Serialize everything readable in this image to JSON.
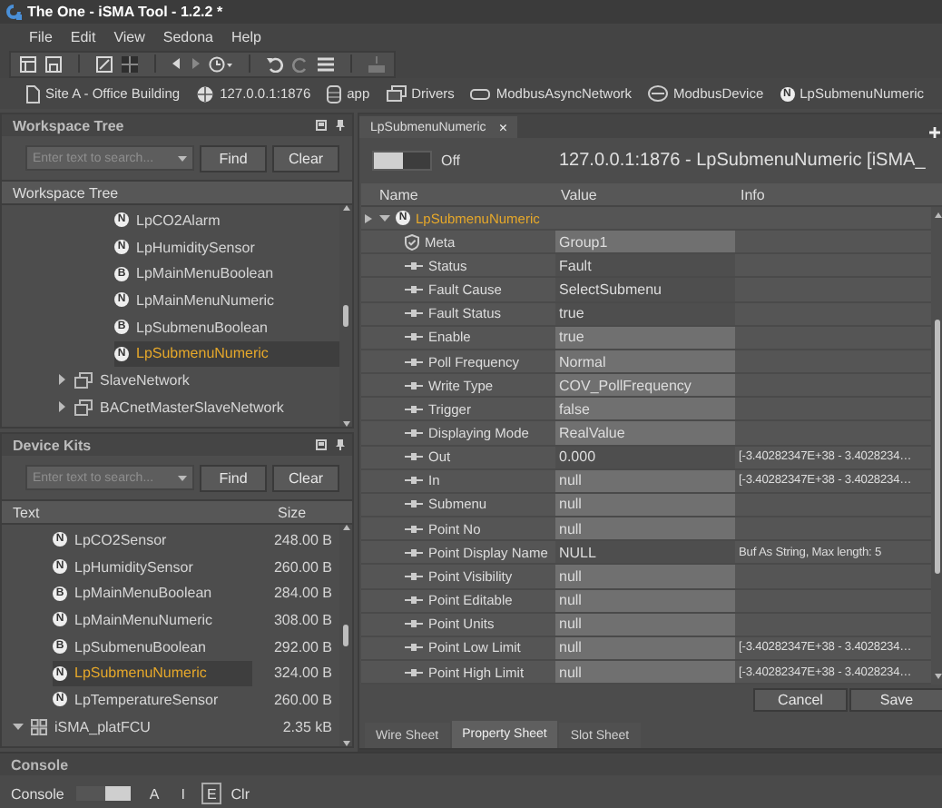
{
  "window": {
    "title": "The One - iSMA Tool - 1.2.2 *"
  },
  "menu": [
    "File",
    "Edit",
    "View",
    "Sedona",
    "Help"
  ],
  "breadcrumb": [
    {
      "label": "Site A - Office Building",
      "kind": "page"
    },
    {
      "label": "127.0.0.1:1876",
      "kind": "server"
    },
    {
      "label": "app",
      "kind": "database"
    },
    {
      "label": "Drivers",
      "kind": "folder"
    },
    {
      "label": "ModbusAsyncNetwork",
      "kind": "network"
    },
    {
      "label": "ModbusDevice",
      "kind": "device"
    },
    {
      "label": "LpSubmenuNumeric",
      "kind": "component",
      "badge": "N"
    }
  ],
  "workspace_tree": {
    "title": "Workspace Tree",
    "search": {
      "placeholder": "Enter text to search..."
    },
    "buttons": [
      "Find",
      "Clear"
    ],
    "column": "Workspace Tree",
    "items": [
      {
        "children": [
          {
            "label": "LpCO2Alarm",
            "badge": "N",
            "selected": false
          },
          {
            "label": "LpHumiditySensor",
            "badge": "N",
            "selected": false
          },
          {
            "label": "LpMainMenuBoolean",
            "badge": "B",
            "selected": false
          },
          {
            "label": "LpMainMenuNumeric",
            "badge": "N",
            "selected": false
          },
          {
            "label": "LpSubmenuBoolean",
            "badge": "B",
            "selected": false
          },
          {
            "label": "LpSubmenuNumeric",
            "badge": "N",
            "selected": true
          }
        ]
      },
      {
        "label": "SlaveNetwork",
        "kind": "network",
        "expanded": false,
        "selected": false
      },
      {
        "label": "BACnetMasterSlaveNetwork",
        "kind": "network",
        "expanded": false,
        "selected": false
      }
    ]
  },
  "device_kits": {
    "title": "Device Kits",
    "search": {
      "placeholder": "Enter text to search..."
    },
    "buttons": [
      "Find",
      "Clear"
    ],
    "columns": [
      "Text",
      "Size"
    ],
    "items": [
      {
        "children": [
          {
            "label": "LpCO2Sensor",
            "badge": "N",
            "size": "248.00 B",
            "selected": false
          },
          {
            "label": "LpHumiditySensor",
            "badge": "N",
            "size": "260.00 B",
            "selected": false
          },
          {
            "label": "LpMainMenuBoolean",
            "badge": "B",
            "size": "284.00 B",
            "selected": false
          },
          {
            "label": "LpMainMenuNumeric",
            "badge": "N",
            "size": "308.00 B",
            "selected": false
          },
          {
            "label": "LpSubmenuBoolean",
            "badge": "B",
            "size": "292.00 B",
            "selected": false
          },
          {
            "label": "LpSubmenuNumeric",
            "badge": "N",
            "size": "324.00 B",
            "selected": true
          },
          {
            "label": "LpTemperatureSensor",
            "badge": "N",
            "size": "260.00 B",
            "selected": false
          }
        ]
      },
      {
        "label": "iSMA_platFCU",
        "kind": "kit",
        "size": "2.35 kB",
        "expanded": true,
        "selected": false
      }
    ]
  },
  "editor": {
    "tab": {
      "label": "LpSubmenuNumeric",
      "close": "×"
    },
    "toggle": {
      "on": false,
      "label": "Off"
    },
    "title": "127.0.0.1:1876 - LpSubmenuNumeric [iSMA_",
    "columns": [
      "Name",
      "Value",
      "Info"
    ],
    "root": {
      "label": "LpSubmenuNumeric",
      "badge": "N",
      "expanded": true,
      "children": [
        {
          "name": "Meta",
          "kind": "meta",
          "value": "Group1",
          "editable": true
        },
        {
          "name": "Status",
          "kind": "slot",
          "value": "Fault",
          "editable": false
        },
        {
          "name": "Fault Cause",
          "kind": "slot",
          "value": "SelectSubmenu",
          "editable": false
        },
        {
          "name": "Fault Status",
          "kind": "slot",
          "value": "true",
          "editable": false
        },
        {
          "name": "Enable",
          "kind": "slot",
          "value": "true",
          "editable": true
        },
        {
          "name": "Poll Frequency",
          "kind": "slot",
          "value": "Normal",
          "editable": true
        },
        {
          "name": "Write Type",
          "kind": "slot",
          "value": "COV_PollFrequency",
          "editable": true
        },
        {
          "name": "Trigger",
          "kind": "slot",
          "value": "false",
          "editable": true
        },
        {
          "name": "Displaying Mode",
          "kind": "slot",
          "value": "RealValue",
          "editable": true
        },
        {
          "name": "Out",
          "kind": "slot",
          "value": "0.000",
          "info": "[-3.40282347E+38 - 3.4028234…",
          "editable": false
        },
        {
          "name": "In",
          "kind": "slot",
          "value": "null",
          "info": "[-3.40282347E+38 - 3.4028234…",
          "editable": true
        },
        {
          "name": "Submenu",
          "kind": "slot",
          "value": "null",
          "editable": true
        },
        {
          "name": "Point No",
          "kind": "slot",
          "value": "null",
          "editable": true
        },
        {
          "name": "Point Display Name",
          "kind": "slot",
          "value": "NULL",
          "info": "Buf As String, Max length: 5",
          "editable": false
        },
        {
          "name": "Point Visibility",
          "kind": "slot",
          "value": "null",
          "editable": true
        },
        {
          "name": "Point Editable",
          "kind": "slot",
          "value": "null",
          "editable": true
        },
        {
          "name": "Point Units",
          "kind": "slot",
          "value": "null",
          "editable": true
        },
        {
          "name": "Point Low Limit",
          "kind": "slot",
          "value": "null",
          "info": "[-3.40282347E+38 - 3.4028234…",
          "editable": true
        },
        {
          "name": "Point High Limit",
          "kind": "slot",
          "value": "null",
          "info": "[-3.40282347E+38 - 3.4028234…",
          "editable": true
        }
      ]
    },
    "actions": [
      "Cancel",
      "Save"
    ],
    "views": [
      {
        "label": "Wire Sheet",
        "selected": false
      },
      {
        "label": "Property Sheet",
        "selected": true
      },
      {
        "label": "Slot Sheet",
        "selected": false
      }
    ]
  },
  "console": {
    "title": "Console",
    "label": "Console",
    "toggle": {
      "on": true
    },
    "filters": [
      {
        "label": "A",
        "selected": false
      },
      {
        "label": "I",
        "selected": false
      },
      {
        "label": "E",
        "selected": true
      }
    ],
    "clear": "Clr"
  }
}
